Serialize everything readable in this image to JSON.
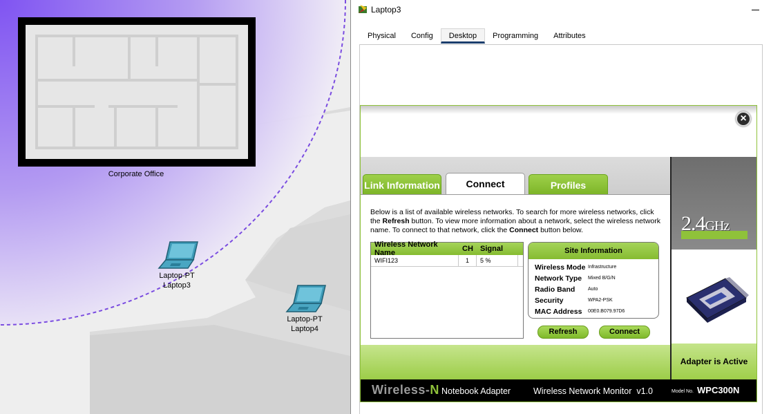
{
  "workspace": {
    "office_label": "Corporate Office",
    "devices": [
      {
        "type": "Laptop-PT",
        "name": "Laptop3"
      },
      {
        "type": "Laptop-PT",
        "name": "Laptop4"
      }
    ]
  },
  "window": {
    "title": "Laptop3",
    "tabs": [
      {
        "label": "Physical"
      },
      {
        "label": "Config"
      },
      {
        "label": "Desktop"
      },
      {
        "label": "Programming"
      },
      {
        "label": "Attributes"
      }
    ],
    "active_tab": "Desktop"
  },
  "monitor": {
    "tabs": {
      "link_information": "Link Information",
      "connect": "Connect",
      "profiles": "Profiles"
    },
    "description": {
      "part1": "Below is a list of available wireless networks. To search for more wireless networks, click the ",
      "refresh_word": "Refresh",
      "part2": " button. To view more information about a network, select the wireless network name. To connect to that network, click the ",
      "connect_word": "Connect",
      "part3": " button below."
    },
    "network_table": {
      "headers": [
        "Wireless Network Name",
        "CH",
        "Signal"
      ],
      "rows": [
        {
          "name": "WIFI123",
          "ch": "1",
          "signal": "5 %"
        }
      ]
    },
    "site_info": {
      "title": "Site Information",
      "rows": [
        {
          "label": "Wireless Mode",
          "value": "Infrastructure"
        },
        {
          "label": "Network Type",
          "value": "Mixed B/G/N"
        },
        {
          "label": "Radio Band",
          "value": "Auto"
        },
        {
          "label": "Security",
          "value": "WPA2-PSK"
        },
        {
          "label": "MAC Address",
          "value": "00E0.B079.97D6"
        }
      ]
    },
    "buttons": {
      "refresh": "Refresh",
      "connect": "Connect"
    },
    "band": {
      "number": "2.4",
      "unit": "GHz"
    },
    "adapter_status": "Adapter is Active",
    "footer": {
      "brand_prefix": "Wireless-",
      "brand_suffix": "N",
      "subtitle1": "Notebook Adapter",
      "subtitle2": "Wireless Network Monitor  v1.0",
      "model_label": "Model No.",
      "model": "WPC300N"
    }
  },
  "colors": {
    "accent_green": "#8fc23a",
    "wireless_range": "#8a5cf6",
    "tab_underline": "#1b3e6d"
  }
}
